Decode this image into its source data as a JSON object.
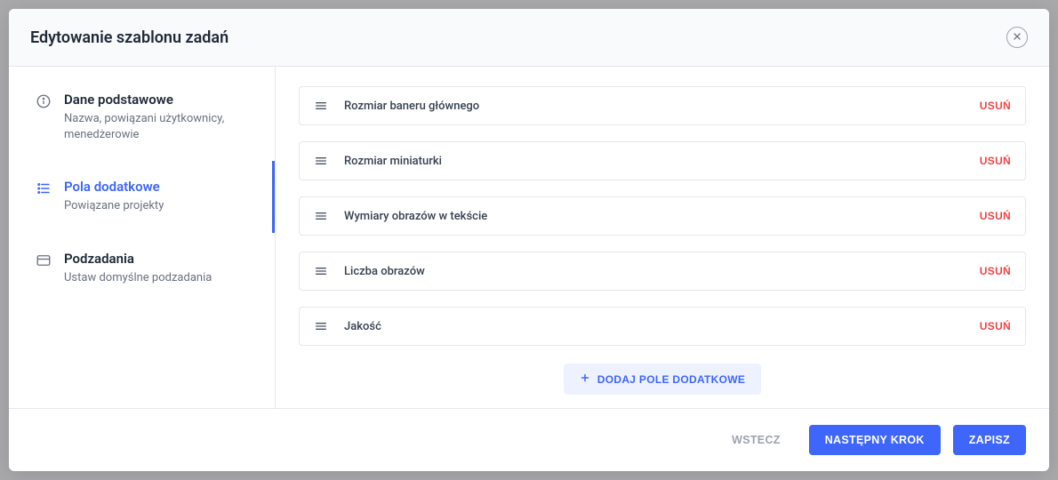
{
  "header": {
    "title": "Edytowanie szablonu zadań"
  },
  "sidebar": {
    "items": [
      {
        "label": "Dane podstawowe",
        "sub": "Nazwa, powiązani użytkownicy, menedżerowie"
      },
      {
        "label": "Pola dodatkowe",
        "sub": "Powiązane projekty"
      },
      {
        "label": "Podzadania",
        "sub": "Ustaw domyślne podzadania"
      }
    ]
  },
  "fields": {
    "delete_label": "USUŃ",
    "items": [
      {
        "name": "Rozmiar baneru głównego"
      },
      {
        "name": "Rozmiar miniaturki"
      },
      {
        "name": "Wymiary obrazów w tekście"
      },
      {
        "name": "Liczba obrazów"
      },
      {
        "name": "Jakość"
      }
    ]
  },
  "actions": {
    "add": "DODAJ POLE DODATKOWE",
    "back": "WSTECZ",
    "next": "NASTĘPNY KROK",
    "save": "ZAPISZ"
  }
}
